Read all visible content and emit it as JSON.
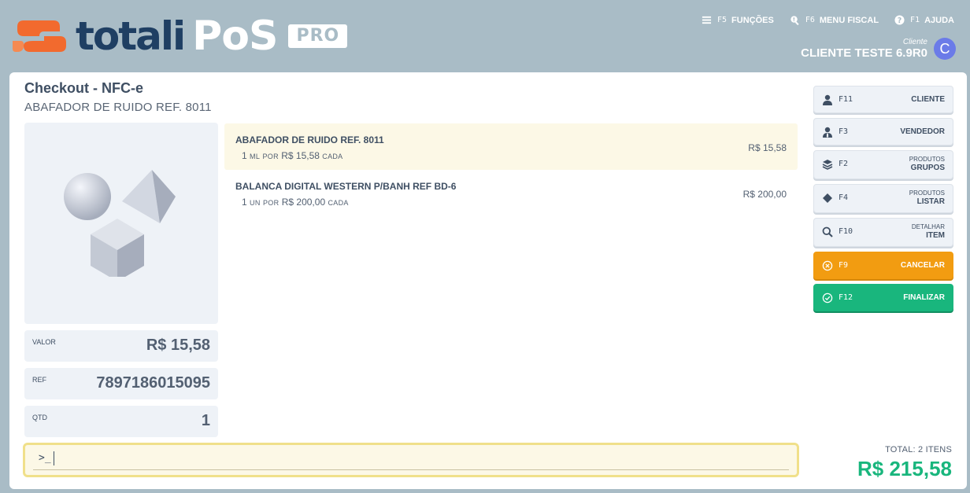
{
  "brand": {
    "logo_word_a": "totali",
    "logo_word_b": "PoS",
    "badge": "PRO"
  },
  "topnav": [
    {
      "key": "F5",
      "label": "FUNÇÕES",
      "icon": "menu-icon"
    },
    {
      "key": "F6",
      "label": "MENU FISCAL",
      "icon": "search-icon"
    },
    {
      "key": "F1",
      "label": "AJUDA",
      "icon": "help-icon"
    }
  ],
  "client": {
    "label": "Cliente",
    "name": "CLIENTE TESTE 6.9R0",
    "initial": "C"
  },
  "page": {
    "title": "Checkout - NFC-e",
    "subtitle": "ABAFADOR DE RUIDO REF. 8011"
  },
  "stats": {
    "valor": {
      "label": "VALOR",
      "value": "R$ 15,58"
    },
    "ref": {
      "label": "REF",
      "value": "7897186015095"
    },
    "qtd": {
      "label": "QTD",
      "value": "1"
    }
  },
  "items": [
    {
      "name": "ABAFADOR DE RUIDO REF. 8011",
      "qty": "1",
      "unit": "ML",
      "por": "POR",
      "unit_price": "R$ 15,58",
      "cada": "CADA",
      "price": "R$ 15,58",
      "selected": true
    },
    {
      "name": "BALANCA DIGITAL WESTERN P/BANH REF BD-6",
      "qty": "1",
      "unit": "UN",
      "por": "POR",
      "unit_price": "R$ 200,00",
      "cada": "CADA",
      "price": "R$ 200,00",
      "selected": false
    }
  ],
  "command": {
    "prompt": ">_",
    "value": ""
  },
  "sidebar": [
    {
      "key": "F11",
      "top": "",
      "label": "CLIENTE",
      "icon": "user-icon"
    },
    {
      "key": "F3",
      "top": "",
      "label": "VENDEDOR",
      "icon": "seller-icon"
    },
    {
      "key": "F2",
      "top": "PRODUTOS",
      "label": "GRUPOS",
      "icon": "layers-icon"
    },
    {
      "key": "F4",
      "top": "PRODUTOS",
      "label": "LISTAR",
      "icon": "diamond-icon"
    },
    {
      "key": "F10",
      "top": "DETALHAR",
      "label": "ITEM",
      "icon": "search-icon"
    },
    {
      "key": "F9",
      "top": "",
      "label": "CANCELAR",
      "icon": "cancel-icon"
    },
    {
      "key": "F12",
      "top": "",
      "label": "FINALIZAR",
      "icon": "check-circle-icon"
    }
  ],
  "total": {
    "label": "TOTAL: 2 ITENS",
    "value": "R$ 215,58"
  },
  "colors": {
    "header_bg": "#a9bcc6",
    "accent_orange": "#f29c11",
    "accent_green": "#19b67d",
    "logo_blue": "#1f3f63",
    "logo_orange": "#f26a2e"
  }
}
